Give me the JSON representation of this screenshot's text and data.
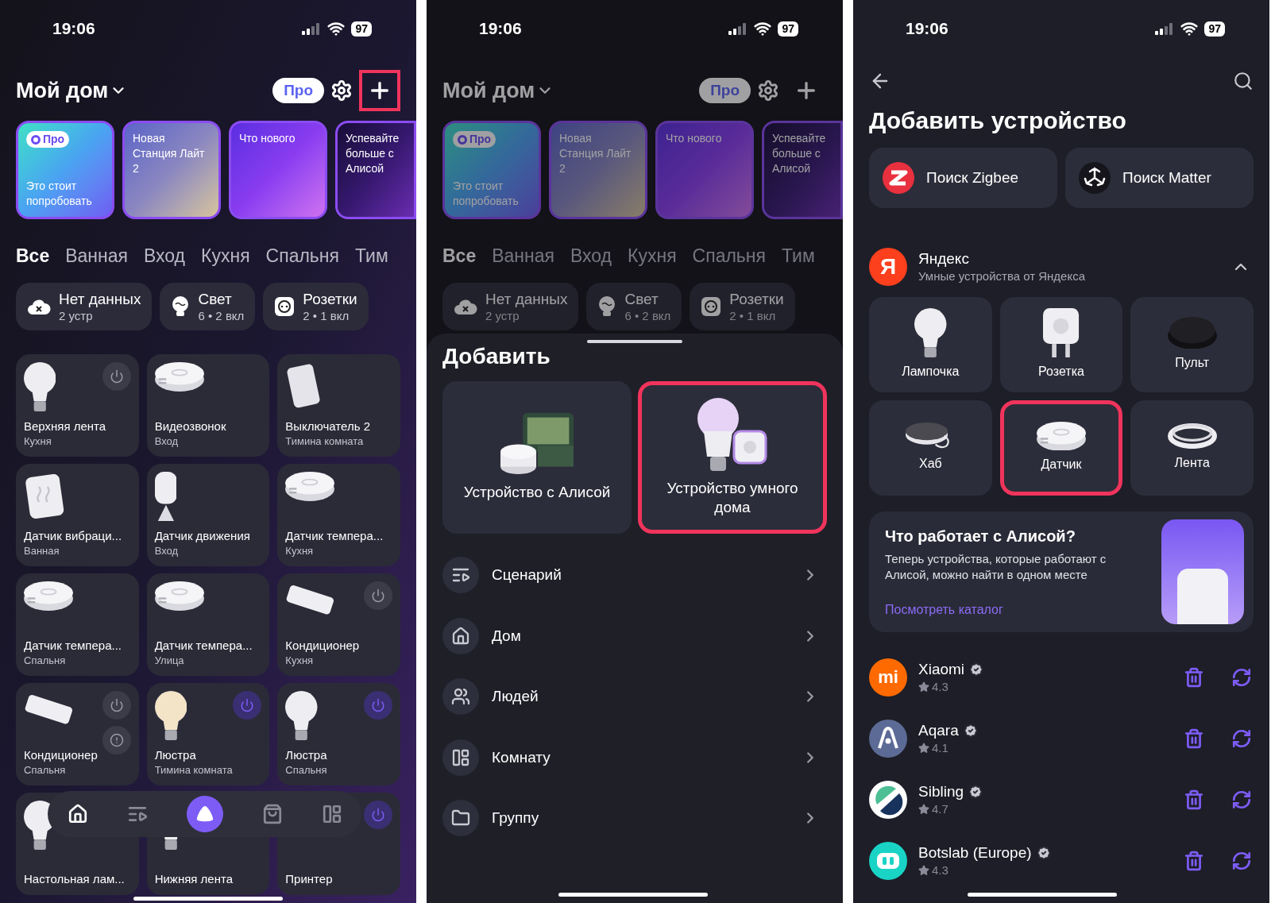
{
  "home_screen": {
    "status_bar": {
      "time": "19:06",
      "battery": "97"
    },
    "header": {
      "title": "Мой дом",
      "pro_label": "Про",
      "add_button": {
        "highlighted": true
      }
    },
    "stories": [
      {
        "kind": "pro",
        "badge": "Про",
        "text": "Это стоит попробовать"
      },
      {
        "kind": "photo",
        "text": "Новая Станция Лайт 2"
      },
      {
        "kind": "waves",
        "text": "Что нового"
      },
      {
        "kind": "space",
        "text": "Успевайте больше с Алисой"
      }
    ],
    "room_tabs": [
      {
        "label": "Все",
        "selected": true
      },
      {
        "label": "Ванная",
        "selected": false
      },
      {
        "label": "Вход",
        "selected": false
      },
      {
        "label": "Кухня",
        "selected": false
      },
      {
        "label": "Спальня",
        "selected": false
      },
      {
        "label": "Тим",
        "selected": false
      }
    ],
    "chips": [
      {
        "kind": "cloud_x",
        "title": "Нет данных",
        "subtitle": "2 устр"
      },
      {
        "kind": "bulb",
        "title": "Свет",
        "subtitle": "6 • 2 вкл"
      },
      {
        "kind": "socket",
        "title": "Розетки",
        "subtitle": "2 • 1 вкл"
      }
    ],
    "devices": [
      {
        "kind": "bulb",
        "name": "Верхняя лента",
        "room": "Кухня",
        "controls": [
          {
            "kind": "power",
            "on": false
          }
        ]
      },
      {
        "kind": "puck",
        "name": "Видеозвонок",
        "room": "Вход"
      },
      {
        "kind": "switch",
        "name": "Выключатель 2",
        "room": "Тимина комната"
      },
      {
        "kind": "vibration",
        "name": "Датчик вибраци...",
        "room": "Ванная"
      },
      {
        "kind": "motion",
        "name": "Датчик движения",
        "room": "Вход"
      },
      {
        "kind": "puck",
        "name": "Датчик темпера...",
        "room": "Кухня"
      },
      {
        "kind": "puck",
        "name": "Датчик темпера...",
        "room": "Спальня"
      },
      {
        "kind": "puck",
        "name": "Датчик темпера...",
        "room": "Улица"
      },
      {
        "kind": "ac",
        "name": "Кондиционер",
        "room": "Кухня",
        "controls": [
          {
            "kind": "power",
            "on": false
          }
        ]
      },
      {
        "kind": "ac",
        "name": "Кондиционер",
        "room": "Спальня",
        "controls": [
          {
            "kind": "power",
            "on": false
          },
          {
            "kind": "alert"
          }
        ]
      },
      {
        "kind": "warm_bulb",
        "name": "Люстра",
        "room": "Тимина комната",
        "controls": [
          {
            "kind": "power",
            "on": true
          }
        ]
      },
      {
        "kind": "bulb",
        "name": "Люстра",
        "room": "Спальня",
        "controls": [
          {
            "kind": "power",
            "on": true
          }
        ]
      },
      {
        "kind": "bulb",
        "name": "Настольная лам..."
      },
      {
        "kind": "bulb",
        "name": "Нижняя лента"
      },
      {
        "kind": "none",
        "name": "Принтер",
        "controls": [
          {
            "kind": "power",
            "on": true
          }
        ]
      }
    ],
    "nav": [
      {
        "kind": "home",
        "selected": true
      },
      {
        "kind": "scenarios",
        "selected": false
      },
      {
        "kind": "alice",
        "selected": false
      },
      {
        "kind": "shop",
        "selected": false
      },
      {
        "kind": "dashboard",
        "selected": false
      }
    ]
  },
  "add_menu_screen": {
    "status_bar": {
      "time": "19:06",
      "battery": "97"
    },
    "background": {
      "header": {
        "title": "Мой дом",
        "pro_label": "Про"
      },
      "stories": [
        {
          "kind": "pro",
          "badge": "Про",
          "text": "Это стоит попробовать"
        },
        {
          "kind": "photo",
          "text": "Новая Станция Лайт 2"
        },
        {
          "kind": "waves",
          "text": "Что нового"
        },
        {
          "kind": "space",
          "text": "Успевайте больше с Алисой"
        }
      ],
      "room_tabs": [
        {
          "label": "Все",
          "selected": true
        },
        {
          "label": "Ванная",
          "selected": false
        },
        {
          "label": "Вход",
          "selected": false
        },
        {
          "label": "Кухня",
          "selected": false
        },
        {
          "label": "Спальня",
          "selected": false
        },
        {
          "label": "Тим",
          "selected": false
        }
      ],
      "chips": [
        {
          "kind": "cloud_x",
          "title": "Нет данных",
          "subtitle": "2 устр"
        },
        {
          "kind": "bulb",
          "title": "Свет",
          "subtitle": "6 • 2 вкл"
        },
        {
          "kind": "socket",
          "title": "Розетки",
          "subtitle": "2 • 1 вкл"
        }
      ]
    },
    "sheet": {
      "title": "Добавить",
      "options": [
        {
          "kind": "station",
          "label": "Устройство с Алисой",
          "highlighted": false
        },
        {
          "kind": "color_bulb",
          "label": "Устройство умного дома",
          "highlighted": true
        }
      ],
      "items": [
        {
          "kind": "scenario",
          "label": "Сценарий"
        },
        {
          "kind": "home",
          "label": "Дом"
        },
        {
          "kind": "people",
          "label": "Людей"
        },
        {
          "kind": "room",
          "label": "Комнату"
        },
        {
          "kind": "group",
          "label": "Группу"
        }
      ]
    }
  },
  "add_device_screen": {
    "status_bar": {
      "time": "19:06",
      "battery": "97"
    },
    "title": "Добавить устройство",
    "search_buttons": [
      {
        "kind": "zigbee",
        "label": "Поиск Zigbee"
      },
      {
        "kind": "matter",
        "label": "Поиск Matter"
      }
    ],
    "brand": {
      "logo_text": "Я",
      "name": "Яндекс",
      "subtitle": "Умные устройства от Яндекса",
      "expanded": true,
      "products": [
        {
          "kind": "bulb",
          "label": "Лампочка",
          "highlighted": false
        },
        {
          "kind": "socket",
          "label": "Розетка",
          "highlighted": false
        },
        {
          "kind": "remote",
          "label": "Пульт",
          "highlighted": false
        },
        {
          "kind": "hub",
          "label": "Хаб",
          "highlighted": false
        },
        {
          "kind": "puck",
          "label": "Датчик",
          "highlighted": true
        },
        {
          "kind": "strip",
          "label": "Лента",
          "highlighted": false
        }
      ]
    },
    "promo": {
      "title": "Что работает с Алисой?",
      "text": "Теперь устройства, которые работают с Алисой, можно найти в одном месте",
      "link": "Посмотреть каталог"
    },
    "vendors": [
      {
        "kind": "xiaomi",
        "logo_text": "mi",
        "name": "Xiaomi",
        "rating": "4.3",
        "verified": true
      },
      {
        "kind": "aqara",
        "name": "Aqara",
        "rating": "4.1",
        "verified": true
      },
      {
        "kind": "sibling",
        "name": "Sibling",
        "rating": "4.7",
        "verified": true
      },
      {
        "kind": "botslab",
        "name": "Botslab (Europe)",
        "rating": "4.3",
        "verified": true
      }
    ]
  }
}
